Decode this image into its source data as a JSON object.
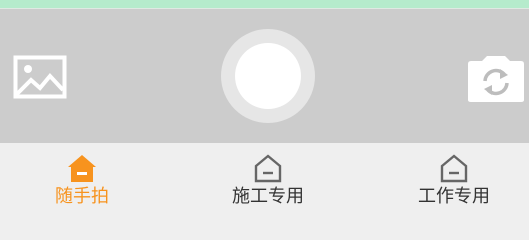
{
  "colors": {
    "top_strip": "#b5ebcc",
    "camera_background": "#cccccc",
    "tab_bar_background": "#efefef",
    "active_tab": "#f7931e",
    "inactive_tab_text": "#333333",
    "inactive_tab_icon": "#666666"
  },
  "camera_controls": {
    "gallery_icon": "image-icon",
    "shutter": "shutter-button",
    "switch_icon": "switch-camera-icon"
  },
  "tabs": [
    {
      "label": "随手拍",
      "icon": "home-icon",
      "active": true
    },
    {
      "label": "施工专用",
      "icon": "home-icon",
      "active": false
    },
    {
      "label": "工作专用",
      "icon": "home-icon",
      "active": false
    }
  ]
}
